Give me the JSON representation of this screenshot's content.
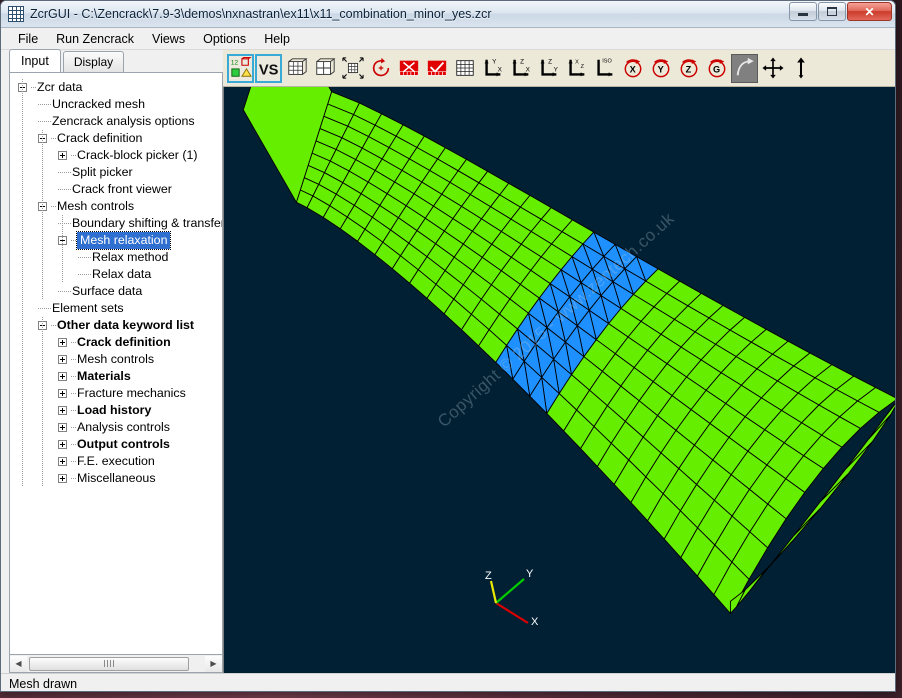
{
  "window": {
    "title": "ZcrGUI - C:\\Zencrack\\7.9-3\\demos\\nxnastran\\ex11\\x11_combination_minor_yes.zcr",
    "icon": "mesh-grid-icon",
    "minimize_label": "Minimize",
    "maximize_label": "Maximize",
    "close_label": "✕"
  },
  "menubar": {
    "items": [
      {
        "label": "File"
      },
      {
        "label": "Run Zencrack"
      },
      {
        "label": "Views"
      },
      {
        "label": "Options"
      },
      {
        "label": "Help"
      }
    ]
  },
  "tabs": [
    {
      "label": "Input",
      "active": true
    },
    {
      "label": "Display",
      "active": false
    }
  ],
  "tree": {
    "nodes": [
      {
        "label": "Zcr data",
        "depth": 0,
        "expander": "minus",
        "bold": false,
        "selected": false
      },
      {
        "label": "Uncracked mesh",
        "depth": 1,
        "expander": "none",
        "bold": false,
        "selected": false
      },
      {
        "label": "Zencrack analysis options",
        "depth": 1,
        "expander": "none",
        "bold": false,
        "selected": false
      },
      {
        "label": "Crack definition",
        "depth": 1,
        "expander": "minus",
        "bold": false,
        "selected": false
      },
      {
        "label": "Crack-block picker (1)",
        "depth": 2,
        "expander": "plus",
        "bold": false,
        "selected": false
      },
      {
        "label": "Split picker",
        "depth": 2,
        "expander": "none",
        "bold": false,
        "selected": false
      },
      {
        "label": "Crack front viewer",
        "depth": 2,
        "expander": "none",
        "bold": false,
        "selected": false
      },
      {
        "label": "Mesh controls",
        "depth": 1,
        "expander": "minus",
        "bold": false,
        "selected": false
      },
      {
        "label": "Boundary shifting & transfer",
        "depth": 2,
        "expander": "none",
        "bold": false,
        "selected": false
      },
      {
        "label": "Mesh relaxation",
        "depth": 2,
        "expander": "minus",
        "bold": false,
        "selected": true
      },
      {
        "label": "Relax method",
        "depth": 3,
        "expander": "none",
        "bold": false,
        "selected": false
      },
      {
        "label": "Relax data",
        "depth": 3,
        "expander": "none",
        "bold": false,
        "selected": false
      },
      {
        "label": "Surface data",
        "depth": 2,
        "expander": "none",
        "bold": false,
        "selected": false
      },
      {
        "label": "Element sets",
        "depth": 1,
        "expander": "none",
        "bold": false,
        "selected": false
      },
      {
        "label": "Other data keyword list",
        "depth": 1,
        "expander": "minus",
        "bold": true,
        "selected": false
      },
      {
        "label": "Crack definition",
        "depth": 2,
        "expander": "plus",
        "bold": true,
        "selected": false
      },
      {
        "label": "Mesh controls",
        "depth": 2,
        "expander": "plus",
        "bold": false,
        "selected": false
      },
      {
        "label": "Materials",
        "depth": 2,
        "expander": "plus",
        "bold": true,
        "selected": false
      },
      {
        "label": "Fracture mechanics",
        "depth": 2,
        "expander": "plus",
        "bold": false,
        "selected": false
      },
      {
        "label": "Load history",
        "depth": 2,
        "expander": "plus",
        "bold": true,
        "selected": false
      },
      {
        "label": "Analysis controls",
        "depth": 2,
        "expander": "plus",
        "bold": false,
        "selected": false
      },
      {
        "label": "Output controls",
        "depth": 2,
        "expander": "plus",
        "bold": true,
        "selected": false
      },
      {
        "label": "F.E. execution",
        "depth": 2,
        "expander": "plus",
        "bold": false,
        "selected": false
      },
      {
        "label": "Miscellaneous",
        "depth": 2,
        "expander": "plus",
        "bold": false,
        "selected": false
      }
    ]
  },
  "scrollbar": {
    "left_arrow": "◀",
    "right_arrow": "▶"
  },
  "toolbar": {
    "buttons": [
      {
        "name": "crack-block-picker-icon",
        "state": "selected"
      },
      {
        "name": "vs-view-select-icon",
        "state": "selected"
      },
      {
        "name": "solid-mesh-icon",
        "state": "normal"
      },
      {
        "name": "shaded-box-icon",
        "state": "normal"
      },
      {
        "name": "zoom-to-fit-icon",
        "state": "normal"
      },
      {
        "name": "rotate-reset-icon",
        "state": "normal"
      },
      {
        "name": "delete-mesh-icon",
        "state": "normal"
      },
      {
        "name": "select-mesh-icon",
        "state": "normal"
      },
      {
        "name": "grid-icon",
        "state": "normal"
      },
      {
        "name": "view-x-axis-icon",
        "state": "normal"
      },
      {
        "name": "view-z-axis-icon",
        "state": "normal"
      },
      {
        "name": "view-y-axis-icon",
        "state": "normal"
      },
      {
        "name": "view-xyz-axis-icon",
        "state": "normal"
      },
      {
        "name": "view-iso-icon",
        "state": "normal"
      },
      {
        "name": "rotate-x-icon",
        "state": "normal"
      },
      {
        "name": "rotate-y-icon",
        "state": "normal"
      },
      {
        "name": "rotate-z-icon",
        "state": "normal"
      },
      {
        "name": "rotate-g-icon",
        "state": "normal"
      },
      {
        "name": "free-rotate-icon",
        "state": "pressed"
      },
      {
        "name": "pan-icon",
        "state": "normal"
      },
      {
        "name": "zoom-axis-icon",
        "state": "normal"
      }
    ],
    "labels": {
      "iso": "ISO",
      "vs": "VS",
      "number": "12"
    }
  },
  "viewport": {
    "background_color": "#012034",
    "mesh_color": "#66EE00",
    "crack_block_color": "#1E90FF",
    "edge_color": "#000000",
    "watermark": "Copyright © 2015 - www.zentech.co.uk",
    "axes": [
      {
        "label": "X",
        "color": "#dd0000"
      },
      {
        "label": "Y",
        "color": "#00cc00"
      },
      {
        "label": "Z",
        "color": "#e8e800"
      }
    ]
  },
  "statusbar": {
    "message": "Mesh drawn"
  }
}
